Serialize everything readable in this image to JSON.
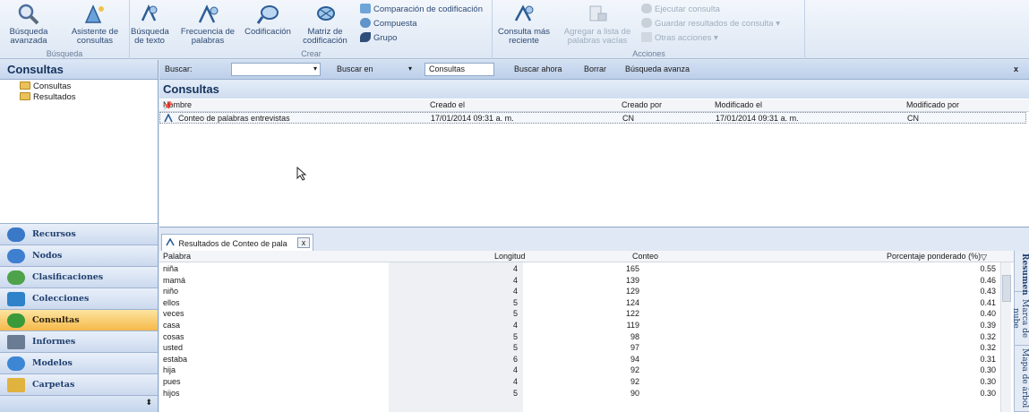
{
  "ribbon": {
    "groups": [
      {
        "label": "Búsqueda",
        "buttons": [
          "Búsqueda avanzada",
          "Asistente de consultas"
        ]
      },
      {
        "label": "Crear",
        "buttons": [
          "Búsqueda de texto",
          "Frecuencia de palabras",
          "Codificación",
          "Matriz de codificación"
        ],
        "small": [
          "Comparación de codificación",
          "Compuesta",
          "Grupo"
        ]
      },
      {
        "label": "Acciones",
        "buttons": [
          "Consulta más reciente",
          "Agregar a lista de palabras vacías"
        ],
        "small": [
          "Ejecutar consulta",
          "Guardar resultados de consulta",
          "Otras acciones"
        ]
      }
    ]
  },
  "left": {
    "title": "Consultas",
    "tree": [
      "Consultas",
      "Resultados"
    ],
    "nav": [
      {
        "label": "Recursos",
        "color": "#3a78c8"
      },
      {
        "label": "Nodos",
        "color": "#3f7fd0"
      },
      {
        "label": "Clasificaciones",
        "color": "#4ea34a"
      },
      {
        "label": "Colecciones",
        "color": "#2d82c9"
      },
      {
        "label": "Consultas",
        "color": "#3a9a3a",
        "active": true
      },
      {
        "label": "Informes",
        "color": "#6a7c93"
      },
      {
        "label": "Modelos",
        "color": "#3d86d4"
      },
      {
        "label": "Carpetas",
        "color": "#e0b23e"
      }
    ]
  },
  "search": {
    "label": "Buscar:",
    "value": "",
    "in_label": "Buscar en",
    "in_value": "Consultas",
    "now": "Buscar ahora",
    "clear": "Borrar",
    "advanced": "Búsqueda avanza",
    "close": "x"
  },
  "consultas": {
    "title": "Consultas",
    "columns": [
      "Nombre",
      "Creado el",
      "Creado por",
      "Modificado el",
      "Modificado por"
    ],
    "rows": [
      [
        "Conteo de palabras entrevistas",
        "17/01/2014 09:31 a. m.",
        "CN",
        "17/01/2014 09:31 a. m.",
        "CN"
      ]
    ]
  },
  "results": {
    "tab_label": "Resultados de Conteo de pala",
    "tab_close": "x",
    "columns": [
      "Palabra",
      "Longitud",
      "Conteo",
      "Porcentaje ponderado (%)"
    ],
    "rows": [
      [
        "niña",
        "4",
        "165",
        "0.55"
      ],
      [
        "mamá",
        "4",
        "139",
        "0.46"
      ],
      [
        "niño",
        "4",
        "129",
        "0.43"
      ],
      [
        "ellos",
        "5",
        "124",
        "0.41"
      ],
      [
        "veces",
        "5",
        "122",
        "0.40"
      ],
      [
        "casa",
        "4",
        "119",
        "0.39"
      ],
      [
        "cosas",
        "5",
        "98",
        "0.32"
      ],
      [
        "usted",
        "5",
        "97",
        "0.32"
      ],
      [
        "estaba",
        "6",
        "94",
        "0.31"
      ],
      [
        "hija",
        "4",
        "92",
        "0.30"
      ],
      [
        "pues",
        "4",
        "92",
        "0.30"
      ],
      [
        "hijos",
        "5",
        "90",
        "0.30"
      ]
    ],
    "side_tabs": [
      "Resumen",
      "Marca de nube",
      "Mapa de árbol"
    ]
  }
}
